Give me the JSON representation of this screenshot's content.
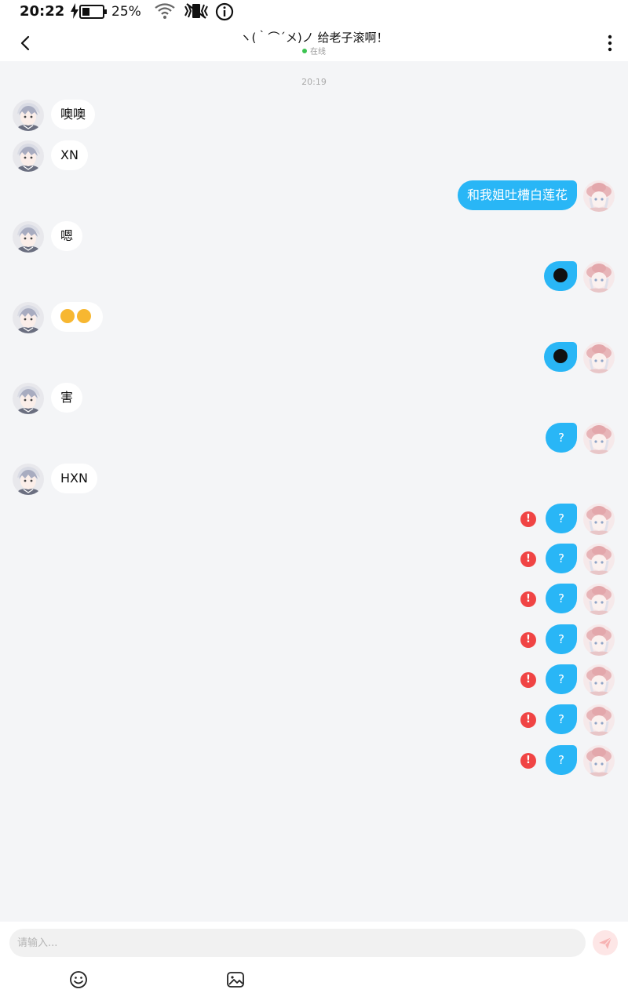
{
  "status_bar": {
    "time": "20:22",
    "battery_percent": "25%"
  },
  "header": {
    "title": "ヽ(｀⌒´メ)ノ 给老子滚啊！",
    "status": "在线",
    "status_color": "#3cc451"
  },
  "chat": {
    "time_separator": "20:19",
    "messages": [
      {
        "side": "left",
        "text": "噢噢"
      },
      {
        "side": "left",
        "text": "XN"
      },
      {
        "side": "right",
        "text": "和我姐吐槽白莲花"
      },
      {
        "side": "left",
        "text": "嗯"
      },
      {
        "side": "right",
        "emoji": "dark-face"
      },
      {
        "side": "left",
        "emoji": "heart-eyes x2"
      },
      {
        "side": "right",
        "emoji": "dark-face"
      },
      {
        "side": "left",
        "text": "害"
      },
      {
        "side": "right",
        "text": "?"
      },
      {
        "side": "left",
        "text": "HXN"
      },
      {
        "side": "right",
        "text": "?",
        "failed": true
      },
      {
        "side": "right",
        "text": "?",
        "failed": true
      },
      {
        "side": "right",
        "text": "?",
        "failed": true
      },
      {
        "side": "right",
        "text": "?",
        "failed": true
      },
      {
        "side": "right",
        "text": "?",
        "failed": true
      },
      {
        "side": "right",
        "text": "?",
        "failed": true
      },
      {
        "side": "right",
        "text": "?",
        "failed": true
      }
    ],
    "error_mark": "!"
  },
  "input": {
    "placeholder": "请输入..."
  },
  "colors": {
    "outgoing_bubble": "#29b6f6",
    "error": "#f04444",
    "background": "#f4f5f7"
  }
}
